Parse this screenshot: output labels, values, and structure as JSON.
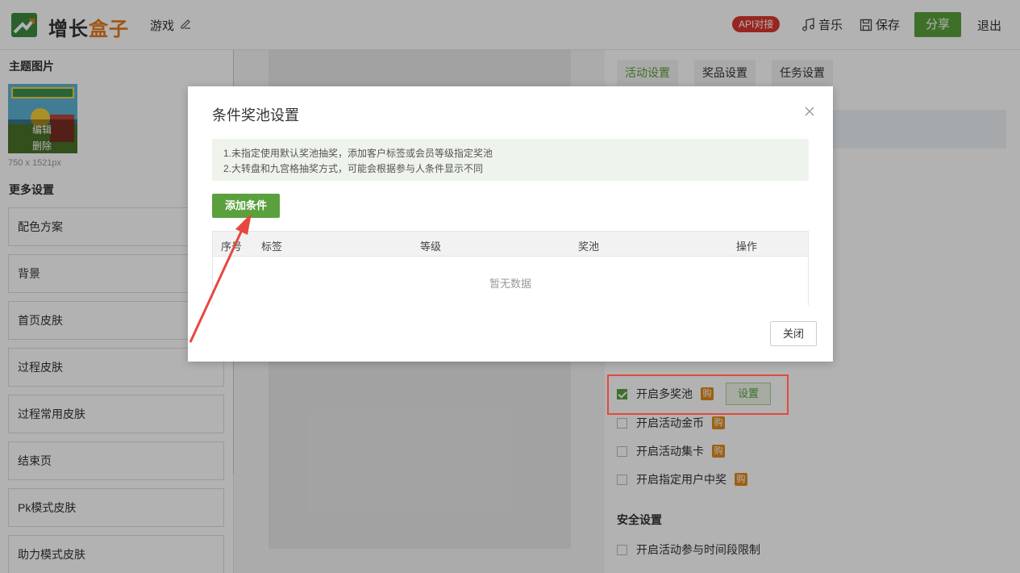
{
  "header": {
    "logo_main": "增长",
    "logo_accent": "盒子",
    "game_title": "游戏",
    "api_badge": "API对接",
    "music_label": "音乐",
    "save_label": "保存",
    "share_label": "分享",
    "logout_label": "退出"
  },
  "left": {
    "theme_title": "主题图片",
    "edit_label": "编辑",
    "delete_label": "删除",
    "image_size": "750 x 1521px",
    "more_title": "更多设置",
    "items": [
      "配色方案",
      "背景",
      "首页皮肤",
      "过程皮肤",
      "过程常用皮肤",
      "结束页",
      "Pk模式皮肤",
      "助力模式皮肤"
    ]
  },
  "right": {
    "tabs": [
      "活动设置",
      "奖品设置",
      "任务设置"
    ],
    "options": [
      {
        "label": "开启多奖池",
        "checked": true,
        "buy": "购",
        "button": "设置"
      },
      {
        "label": "开启活动金币",
        "checked": false,
        "buy": "购"
      },
      {
        "label": "开启活动集卡",
        "checked": false,
        "buy": "购"
      },
      {
        "label": "开启指定用户中奖",
        "checked": false,
        "buy": "购"
      }
    ],
    "safety_title": "安全设置",
    "safety_option": "开启活动参与时间段限制"
  },
  "modal": {
    "title": "条件奖池设置",
    "notice_line1": "1.未指定使用默认奖池抽奖，添加客户标签或会员等级指定奖池",
    "notice_line2": "2.大转盘和九宫格抽奖方式，可能会根据参与人条件显示不同",
    "add_button": "添加条件",
    "columns": [
      "序号",
      "标签",
      "等级",
      "奖池",
      "操作"
    ],
    "empty_text": "暂无数据",
    "close_button": "关闭"
  },
  "colors": {
    "brand_green": "#5aa13d",
    "logo_orange": "#e47b1d",
    "badge_red": "#d9372f",
    "highlight_red": "#e5483f"
  }
}
